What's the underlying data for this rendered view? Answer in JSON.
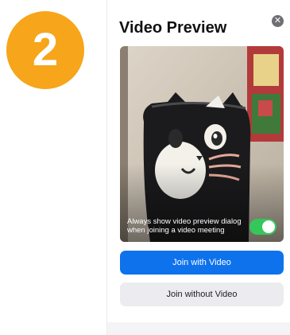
{
  "step": {
    "number": "2"
  },
  "dialog": {
    "title": "Video Preview",
    "close_icon": "close-icon",
    "preview": {
      "toggle_label": "Always show video preview dialog when joining a video meeting",
      "toggle_on": true
    },
    "join_with_video_label": "Join with Video",
    "join_without_video_label": "Join without Video"
  },
  "colors": {
    "step_badge": "#f7a51a",
    "primary_button": "#0e72ed",
    "secondary_button": "#ececf0",
    "toggle_on": "#34c759",
    "close_button": "#6e6e73"
  }
}
